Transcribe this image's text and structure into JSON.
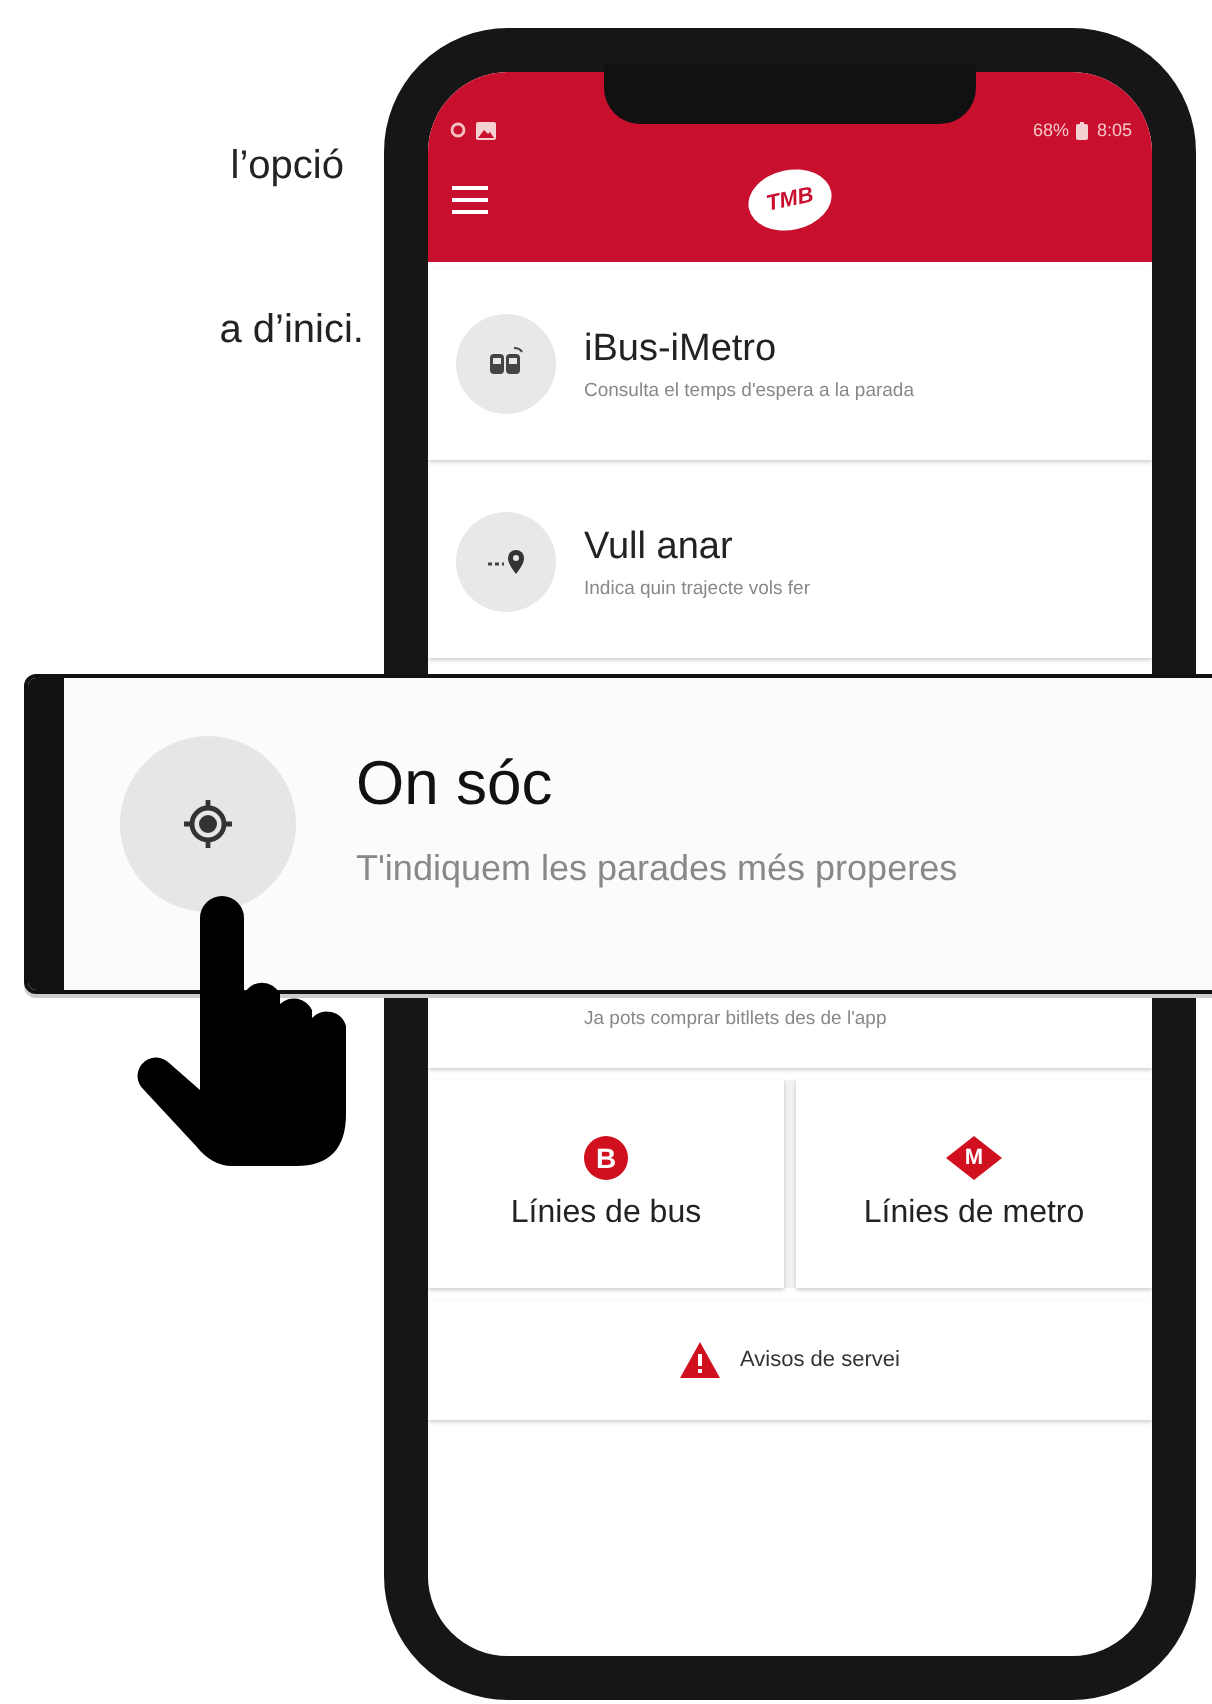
{
  "intro_text": [
    "l’opció",
    "a d’inici."
  ],
  "status_bar": {
    "battery": "68%",
    "time": "8:05"
  },
  "app_bar": {
    "logo_text": "TMB"
  },
  "menu_items": [
    {
      "title": "iBus-iMetro",
      "subtitle": "Consulta el temps d'espera a la parada",
      "kind": "bus"
    },
    {
      "title": "Vull anar",
      "subtitle": "Indica quin trajecte vols fer",
      "kind": "route"
    }
  ],
  "partial_item": {
    "subtitle": "Ja pots comprar bitllets des de l'app"
  },
  "tiles": [
    {
      "label": "Línies de bus",
      "badge": "B",
      "kind": "bus"
    },
    {
      "label": "Línies de metro",
      "badge": "M",
      "kind": "metro"
    }
  ],
  "service_notice": {
    "label": "Avisos de servei"
  },
  "callout": {
    "title": "On sóc",
    "subtitle": "T'indiquem les parades més properes"
  }
}
